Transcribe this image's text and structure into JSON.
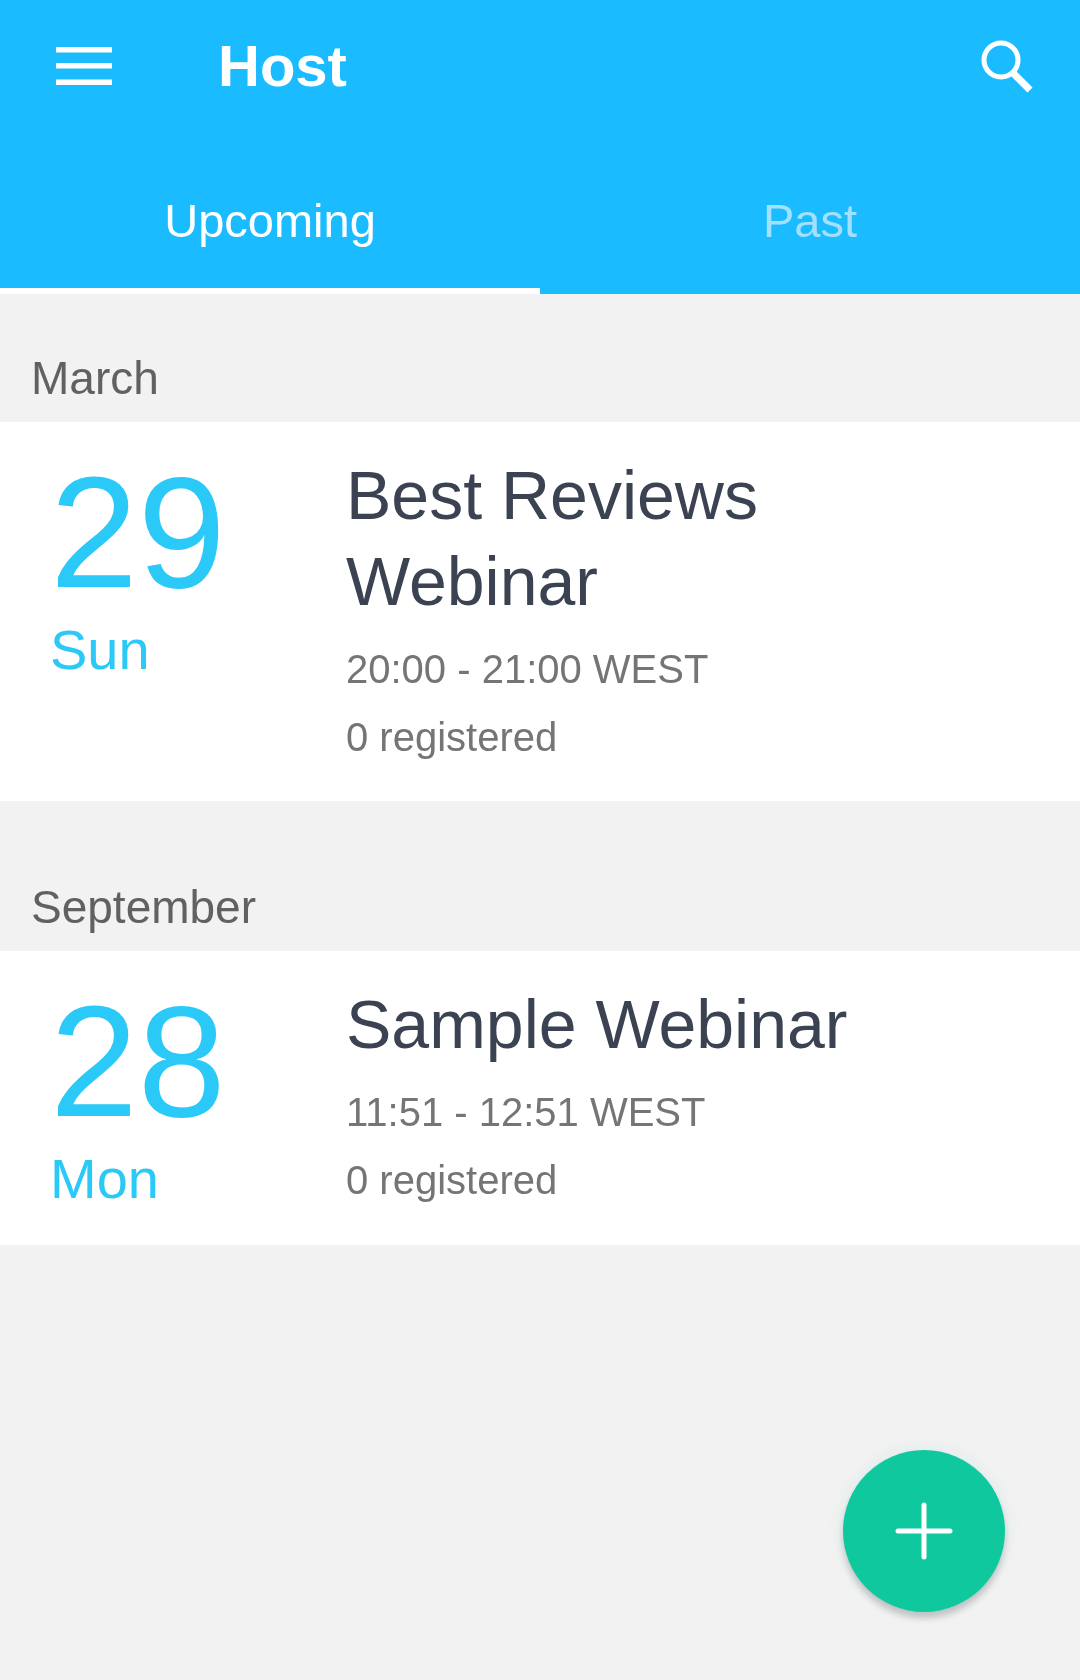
{
  "app_bar": {
    "title": "Host"
  },
  "tabs": [
    {
      "label": "Upcoming",
      "selected": true
    },
    {
      "label": "Past",
      "selected": false
    }
  ],
  "sections": [
    {
      "month": "March",
      "events": [
        {
          "day": "29",
          "weekday": "Sun",
          "title": "Best Reviews Webinar",
          "time": "20:00 - 21:00 WEST",
          "registrations": "0 registered"
        }
      ]
    },
    {
      "month": "September",
      "events": [
        {
          "day": "28",
          "weekday": "Mon",
          "title": "Sample Webinar",
          "time": "11:51 - 12:51 WEST",
          "registrations": "0 registered"
        }
      ]
    }
  ]
}
